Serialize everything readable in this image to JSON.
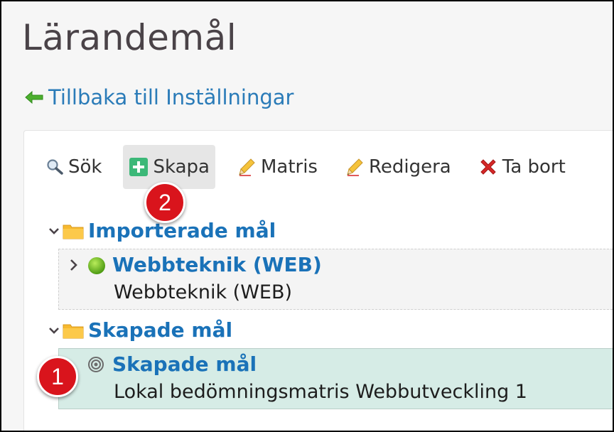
{
  "page": {
    "title": "Lärandemål"
  },
  "nav": {
    "back_label": "Tillbaka till Inställningar"
  },
  "toolbar": {
    "search_label": "Sök",
    "create_label": "Skapa",
    "matrix_label": "Matris",
    "edit_label": "Redigera",
    "delete_label": "Ta bort"
  },
  "badges": {
    "first": "1",
    "second": "2"
  },
  "tree": {
    "imported": {
      "label": "Importerade mål",
      "item": {
        "name": "Webbteknik (WEB)",
        "description": "Webbteknik (WEB)"
      }
    },
    "created": {
      "label": "Skapade mål",
      "item": {
        "name": "Skapade mål",
        "description": "Lokal bedömningsmatris Webbutveckling 1"
      }
    }
  },
  "colors": {
    "link": "#1a72b8",
    "badge": "#d9141c",
    "selected_bg": "#d6ece6",
    "create_icon": "#3cb878"
  }
}
